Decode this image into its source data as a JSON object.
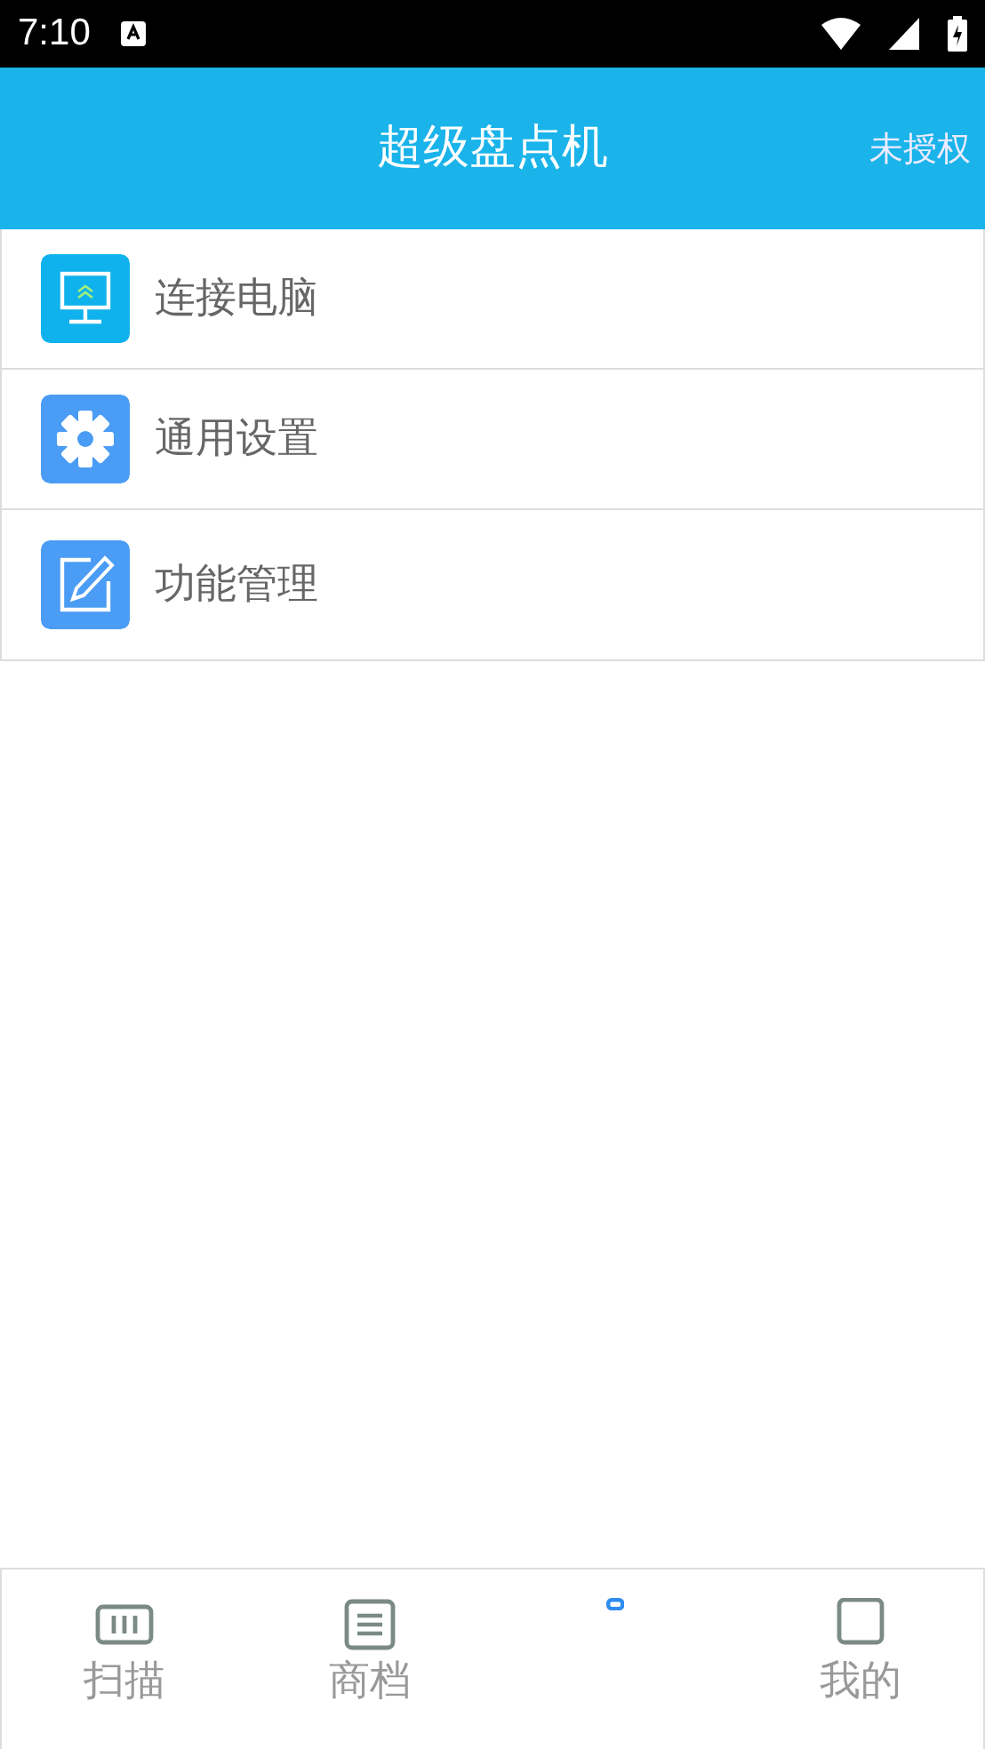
{
  "status_bar": {
    "time": "7:10"
  },
  "header": {
    "title": "超级盘点机",
    "action": "未授权"
  },
  "menu": [
    {
      "kind": "computer",
      "label": "连接电脑"
    },
    {
      "kind": "settings",
      "label": "通用设置"
    },
    {
      "kind": "edit",
      "label": "功能管理"
    }
  ],
  "bottom_nav": [
    {
      "kind": "scan",
      "label": "扫描",
      "selected": false
    },
    {
      "kind": "list",
      "label": "商档",
      "selected": false
    },
    {
      "kind": "chart",
      "selected": true
    },
    {
      "kind": "profile",
      "label": "我的",
      "selected": false
    }
  ]
}
